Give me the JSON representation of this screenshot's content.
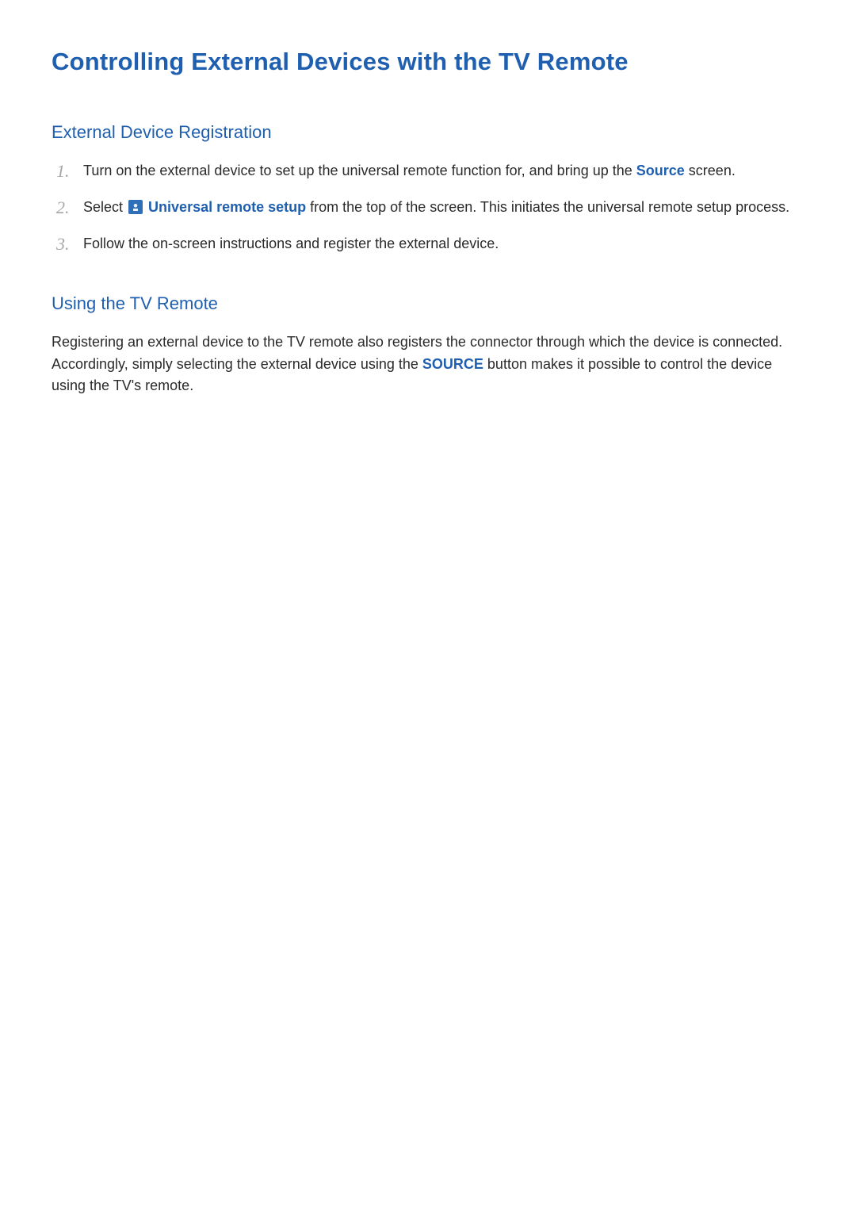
{
  "title": "Controlling External Devices with the TV Remote",
  "section1": {
    "heading": "External Device Registration",
    "steps": [
      {
        "pre": "Turn on the external device to set up the universal remote function for, and bring up the ",
        "keyword": "Source",
        "post": " screen."
      },
      {
        "pre": "Select ",
        "keyword": "Universal remote setup",
        "post": " from the top of the screen. This initiates the universal remote setup process.",
        "has_icon": true
      },
      {
        "pre": "Follow the on-screen instructions and register the external device.",
        "keyword": "",
        "post": ""
      }
    ]
  },
  "section2": {
    "heading": "Using the TV Remote",
    "para_pre": "Registering an external device to the TV remote also registers the connector through which the device is connected. Accordingly, simply selecting the external device using the ",
    "para_keyword": "SOURCE",
    "para_post": " button makes it possible to control the device using the TV's remote."
  }
}
